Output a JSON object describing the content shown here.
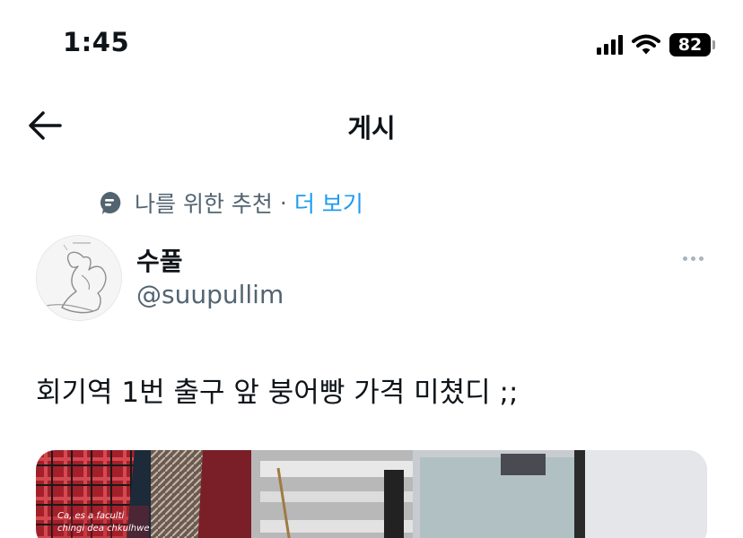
{
  "status_bar": {
    "time": "1:45",
    "battery": "82"
  },
  "nav": {
    "title": "게시"
  },
  "recommendation": {
    "label": "나를 위한 추천",
    "separator": "·",
    "more": "더 보기"
  },
  "author": {
    "name": "수풀",
    "handle": "@suupullim"
  },
  "tweet": {
    "text": "회기역 1번 출구 앞 붕어빵 가격 미쳤디 ;;"
  },
  "media": {
    "sign_line1": "Ca, es a faculti",
    "sign_line2": "chingi dea chkulhwe"
  },
  "icons": {
    "back": "arrow-left-icon",
    "recommendation": "message-bubble-icon",
    "more": "more-dots-icon",
    "signal": "cellular-signal-icon",
    "wifi": "wifi-icon",
    "battery": "battery-icon"
  },
  "colors": {
    "accent": "#1d9bf0",
    "secondary_text": "#536471",
    "primary_text": "#0f1419"
  }
}
